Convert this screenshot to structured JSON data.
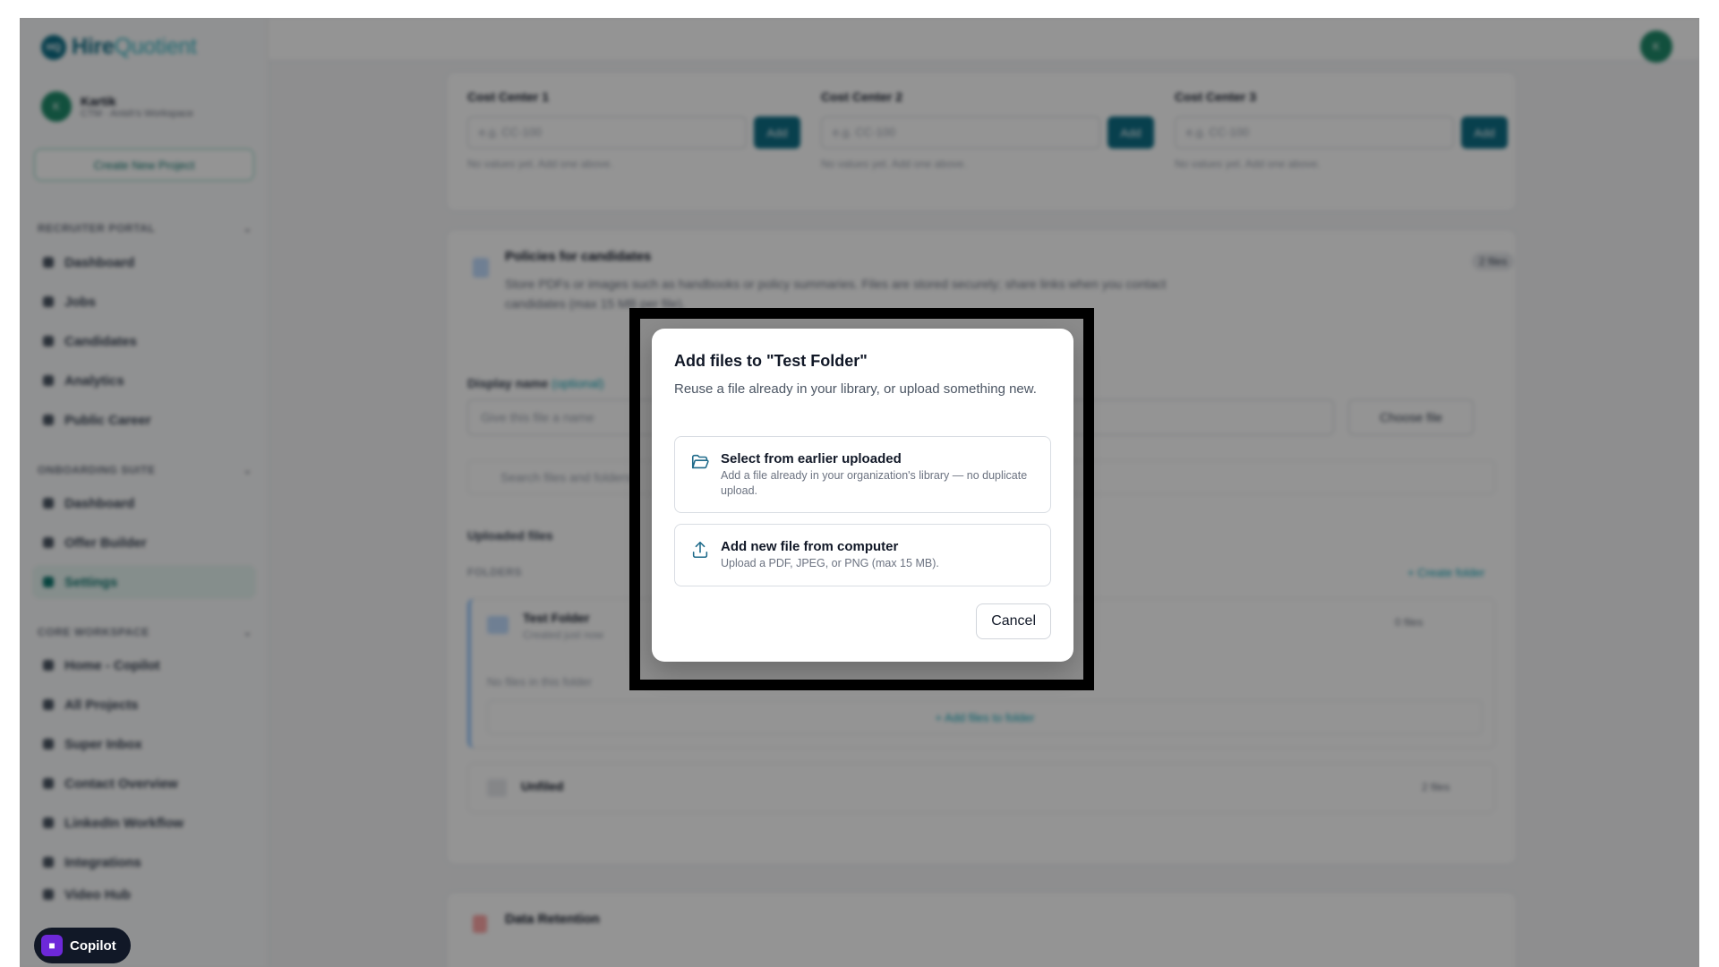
{
  "sidebar": {
    "logo_bold": "Hire",
    "logo_light": "Quotient",
    "logo_mark": "HQ",
    "user_name": "Kartik",
    "user_initial": "K",
    "workspace": "CTM · Anish's Workspace",
    "create_project": "Create New Project",
    "sections": {
      "recruiter": "RECRUITER PORTAL",
      "onboarding": "ONBOARDING SUITE",
      "core": "CORE WORKSPACE"
    },
    "recruiter_items": [
      "Dashboard",
      "Jobs",
      "Candidates",
      "Analytics",
      "Public Career"
    ],
    "onboarding_items": [
      "Dashboard",
      "Offer Builder",
      "Settings"
    ],
    "core_items": [
      "Home - Copilot",
      "All Projects",
      "Super Inbox",
      "Contact Overview",
      "LinkedIn Workflow",
      "Integrations",
      "Video Hub"
    ],
    "copilot_label": "Copilot"
  },
  "main": {
    "top_avatar": "K",
    "cost_centers": [
      {
        "label": "Cost Center 1",
        "placeholder": "e.g. CC-100",
        "add": "Add",
        "note": "No values yet. Add one above."
      },
      {
        "label": "Cost Center 2",
        "placeholder": "e.g. CC-100",
        "add": "Add",
        "note": "No values yet. Add one above."
      },
      {
        "label": "Cost Center 3",
        "placeholder": "e.g. CC-100",
        "add": "Add",
        "note": "No values yet. Add one above."
      }
    ],
    "policies_title": "Policies for candidates",
    "policies_desc": "Store PDFs or images such as handbooks or policy summaries. Files are stored securely; share links when you contact candidates (max 15 MB per file).",
    "policies_badge": "2 files",
    "display_name_label": "Display name",
    "display_name_optional": "(optional)",
    "display_name_placeholder": "Give this file a name",
    "choose_file": "Choose file",
    "search_placeholder": "Search files and folders",
    "uploaded_files": "Uploaded files",
    "folders_label": "FOLDERS",
    "create_folder": "+ Create folder",
    "folder_name": "Test Folder",
    "folder_meta": "Created just now",
    "folder_count": "0 files",
    "folder_empty": "No files in this folder",
    "add_files_to_folder": "+ Add files to folder",
    "unfiled_label": "Unfiled",
    "unfiled_count": "2 files",
    "data_retention": "Data Retention"
  },
  "modal": {
    "title": "Add files to \"Test Folder\"",
    "subtitle": "Reuse a file already in your library, or upload something new.",
    "option1_title": "Select from earlier uploaded",
    "option1_desc": "Add a file already in your organization's library — no duplicate upload.",
    "option2_title": "Add new file from computer",
    "option2_desc": "Upload a PDF, JPEG, or PNG (max 15 MB).",
    "cancel": "Cancel"
  },
  "colors": {
    "brand": "#0e6e86",
    "accent_teal": "#0f766e",
    "modal_icon": "#1e6a8a"
  },
  "icons": {
    "option1": "folder-open-icon",
    "option2": "upload-icon",
    "copilot": "robot-icon"
  }
}
